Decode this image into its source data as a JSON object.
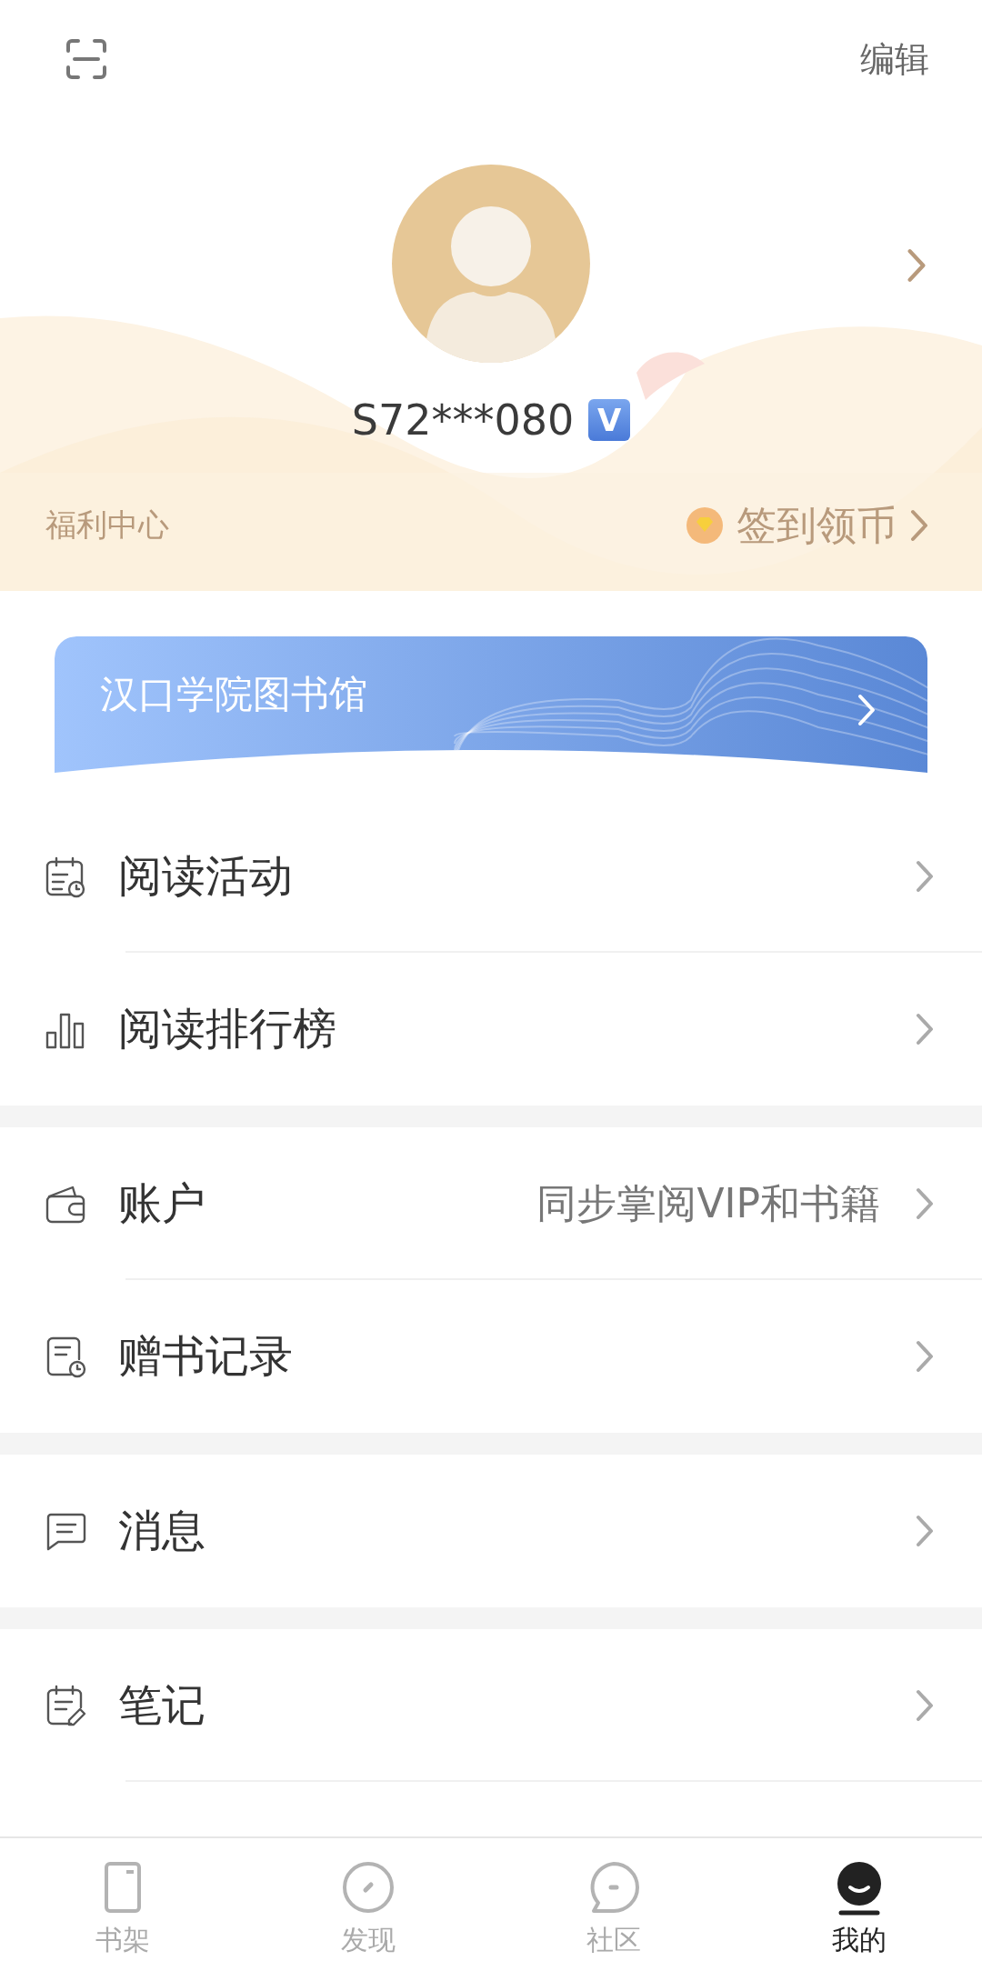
{
  "top_bar": {
    "edit": "编辑"
  },
  "profile": {
    "username": "S72***080",
    "badge": "V"
  },
  "welfare": {
    "title": "福利中心",
    "action": "签到领币"
  },
  "library_banner": {
    "title": "汉口学院图书馆"
  },
  "sections": [
    {
      "items": [
        {
          "kind": "calendar",
          "label": "阅读活动"
        },
        {
          "kind": "chart",
          "label": "阅读排行榜"
        }
      ]
    },
    {
      "items": [
        {
          "kind": "wallet",
          "label": "账户",
          "hint": "同步掌阅VIP和书籍"
        },
        {
          "kind": "record",
          "label": "赠书记录"
        }
      ]
    },
    {
      "items": [
        {
          "kind": "message",
          "label": "消息"
        }
      ]
    },
    {
      "items": [
        {
          "kind": "notes",
          "label": "笔记"
        }
      ]
    }
  ],
  "bottom_nav": [
    {
      "kind": "shelf",
      "label": "书架",
      "selected": false
    },
    {
      "kind": "discover",
      "label": "发现",
      "selected": false
    },
    {
      "kind": "community",
      "label": "社区",
      "selected": false
    },
    {
      "kind": "me",
      "label": "我的",
      "selected": true
    }
  ]
}
